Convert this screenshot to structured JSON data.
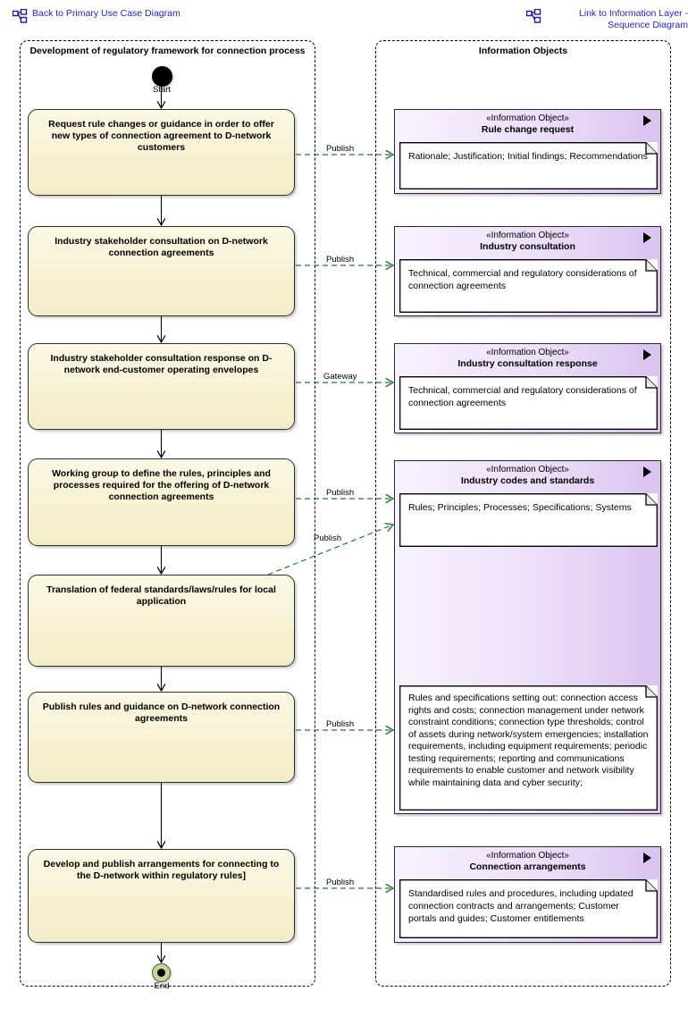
{
  "header": {
    "left_link": {
      "icon": "hierarchy-diagram-icon",
      "label": "Back to Primary Use Case Diagram",
      "color": "#2222cc"
    },
    "right_link": {
      "icon": "hierarchy-diagram-icon",
      "label": "Link to Information Layer - Sequence Diagram",
      "color": "#2222cc"
    }
  },
  "lanes": {
    "left_title": "Development of regulatory framework for connection process",
    "right_title": "Information Objects"
  },
  "nodes": {
    "start_label": "Start",
    "end_label": "End"
  },
  "activities": [
    {
      "text": "Request rule changes or guidance in order to offer new types of connection agreement to D-network customers"
    },
    {
      "text": "Industry stakeholder consultation on D-network connection agreements"
    },
    {
      "text": "Industry stakeholder consultation response on D-network end-customer operating envelopes"
    },
    {
      "text": "Working group to define the rules, principles and processes required for the offering of D-network connection agreements"
    },
    {
      "text": "Translation of federal standards/laws/rules for local application"
    },
    {
      "text": "Publish rules and guidance on D-network connection agreements"
    },
    {
      "text": "Develop and publish arrangements for connecting to the D-network within regulatory rules]"
    }
  ],
  "information_objects": [
    {
      "stereotype": "«Information Object»",
      "name": "Rule change request",
      "note": "Rationale; Justification; Initial findings; Recommendations",
      "play_icon": "play-triangle-icon"
    },
    {
      "stereotype": "«Information Object»",
      "name": "Industry consultation",
      "note": "Technical, commercial and regulatory considerations of connection agreements",
      "play_icon": "play-triangle-icon"
    },
    {
      "stereotype": "«Information Object»",
      "name": "Industry consultation response",
      "note": "Technical, commercial and regulatory considerations of connection agreements",
      "play_icon": "play-triangle-icon"
    },
    {
      "stereotype": "«Information Object»",
      "name": "Industry codes and standards",
      "note": "Rules; Principles; Processes; Specifications; Systems",
      "note2": "Rules and specifications setting out: connection access rights and costs; connection management under network constraint conditions; connection type thresholds; control of assets during network/system emergencies; installation requirements, including equipment requirements; periodic testing  requirements; reporting and communications  requirements to enable customer and network visibility while maintaining data and cyber security;",
      "play_icon": "play-triangle-icon"
    },
    {
      "stereotype": "«Information Object»",
      "name": "Connection arrangements",
      "note": "Standardised rules and procedures, including updated connection contracts and arrangements; Customer portals and guides; Customer entitlements",
      "play_icon": "play-triangle-icon"
    }
  ],
  "connectors": [
    {
      "label": "Publish"
    },
    {
      "label": "Publish"
    },
    {
      "label": "Gateway"
    },
    {
      "label": "Publish"
    },
    {
      "label": "Publish"
    },
    {
      "label": "Publish"
    },
    {
      "label": "Publish"
    }
  ],
  "colors": {
    "link_text": "#2222cc",
    "activity_fill": "#f7f1d3",
    "infobj_fill": "#e4d3f5",
    "connector_green": "#1f7a33",
    "end_node_fill": "#c3d69b"
  }
}
